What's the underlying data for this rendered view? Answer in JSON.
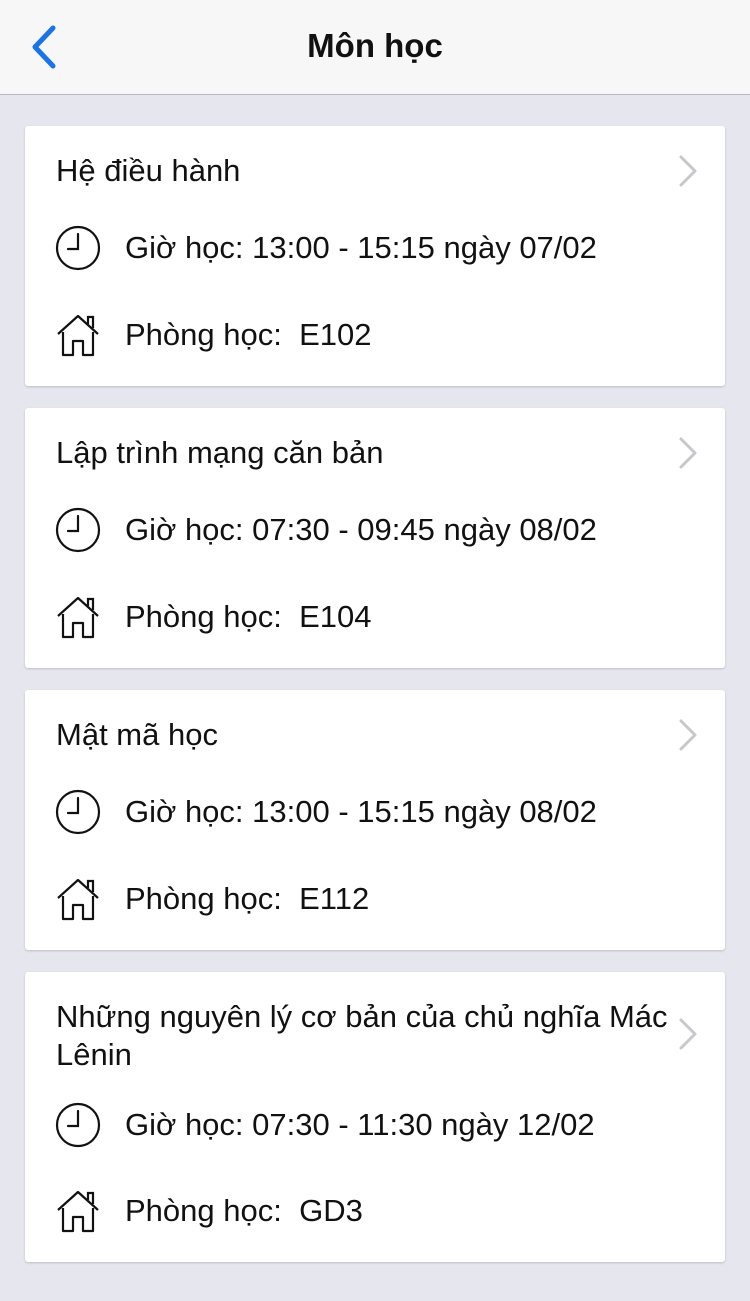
{
  "colors": {
    "accent": "#1a73e8",
    "background": "#e6e6ef",
    "navbar": "#f7f7f7",
    "chevron": "#c7c7cc"
  },
  "header": {
    "title": "Môn học",
    "back_icon": "chevron-left-icon"
  },
  "courses": [
    {
      "name": "Hệ điều hành",
      "time_label": "Giờ học:",
      "time_value": "13:00 - 15:15 ngày 07/02",
      "room_label": "Phòng học:",
      "room_value": "E102"
    },
    {
      "name": "Lập trình mạng căn bản",
      "time_label": "Giờ học:",
      "time_value": "07:30 - 09:45 ngày 08/02",
      "room_label": "Phòng học:",
      "room_value": "E104"
    },
    {
      "name": "Mật mã học",
      "time_label": "Giờ học:",
      "time_value": "13:00 - 15:15 ngày 08/02",
      "room_label": "Phòng học:",
      "room_value": "E112"
    },
    {
      "name": "Những nguyên lý cơ bản của chủ nghĩa Mác Lênin",
      "time_label": "Giờ học:",
      "time_value": "07:30 - 11:30 ngày 12/02",
      "room_label": "Phòng học:",
      "room_value": "GD3"
    }
  ]
}
